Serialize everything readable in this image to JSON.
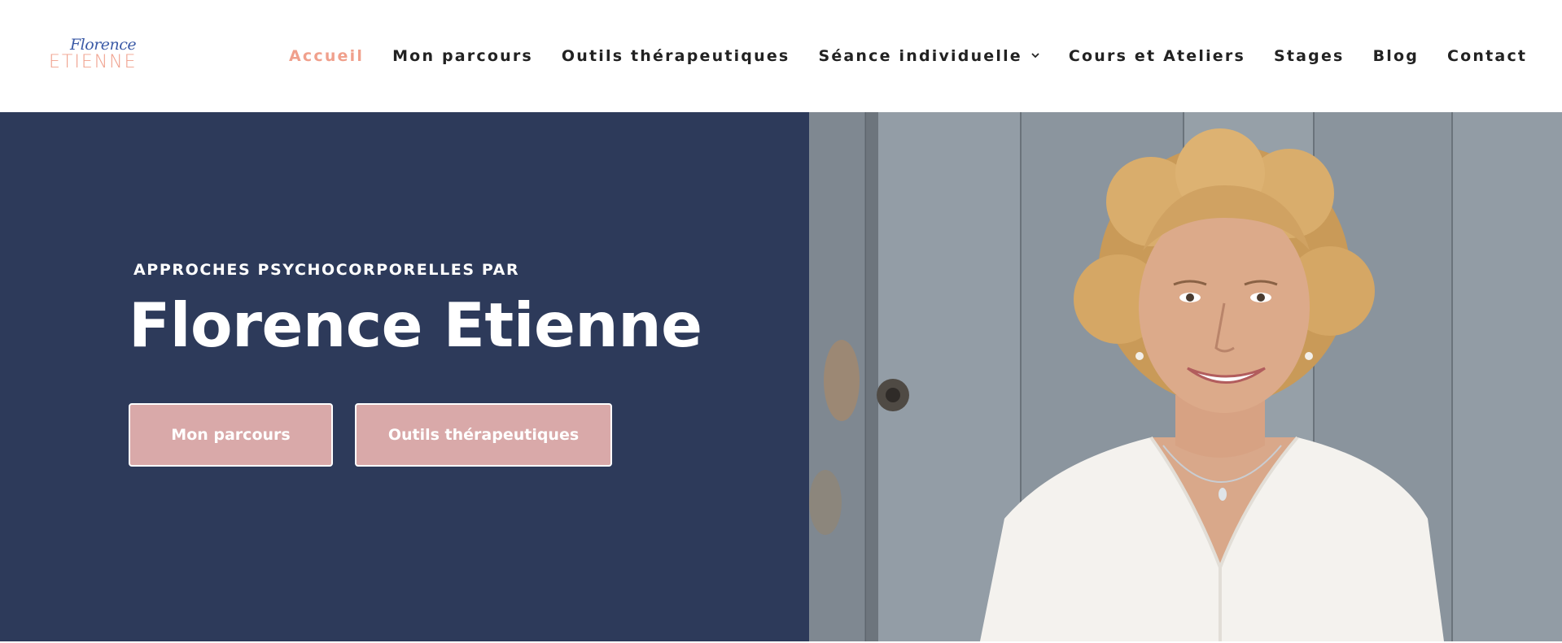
{
  "logo": {
    "script": "Florence",
    "caps": "ETIENNE"
  },
  "nav": {
    "items": [
      {
        "label": "Accueil",
        "active": true
      },
      {
        "label": "Mon parcours"
      },
      {
        "label": "Outils thérapeutiques"
      },
      {
        "label": "Séance individuelle",
        "has_dropdown": true
      },
      {
        "label": "Cours et Ateliers"
      },
      {
        "label": "Stages"
      },
      {
        "label": "Blog"
      },
      {
        "label": "Contact"
      }
    ]
  },
  "hero": {
    "kicker": "APPROCHES PSYCHOCORPORELLES PAR",
    "title": "Florence Etienne",
    "buttons": [
      {
        "label": "Mon parcours"
      },
      {
        "label": "Outils thérapeutiques"
      }
    ]
  },
  "colors": {
    "accent": "#f0a08c",
    "hero_bg": "#2d3a5a",
    "button_bg": "#d9a9a9",
    "logo_blue": "#3b5aa6"
  }
}
